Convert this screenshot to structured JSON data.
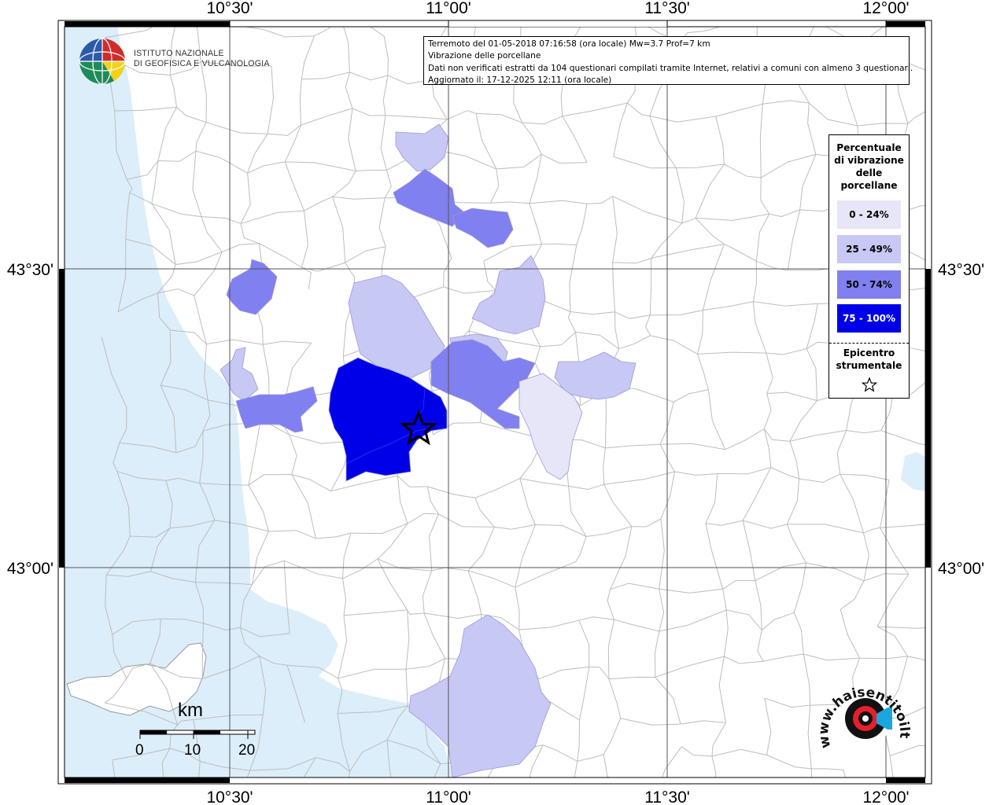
{
  "map": {
    "lon_ticks": [
      "10°30'",
      "11°00'",
      "11°30'",
      "12°00'"
    ],
    "lat_ticks": [
      "43°30'",
      "43°00'"
    ],
    "colors": {
      "sea": "#dceefa",
      "land": "#ffffff",
      "borders": "#bdbdbd",
      "grid": "#555555",
      "class_0_24": "#e6e6f8",
      "class_25_49": "#c8c8f5",
      "class_50_74": "#8080f0",
      "class_75_100": "#0000e8"
    }
  },
  "info": {
    "line1": "Terremoto del 01-05-2018 07:16:58 (ora locale) Mw=3.7 Prof=7 km",
    "line2": "Vibrazione delle porcellane",
    "line3": "Dati non verificati estratti da 104 questionari compilati tramite Internet, relativi a comuni con almeno 3 questionari.",
    "line4": "Aggiornato il: 17-12-2025 12:11 (ora locale)"
  },
  "legend": {
    "title_lines": [
      "Percentuale",
      "di vibrazione",
      "delle",
      "porcellane"
    ],
    "classes": [
      {
        "label": "0 - 24%",
        "color": "#e6e6f8",
        "text_color": "#000000"
      },
      {
        "label": "25 - 49%",
        "color": "#c8c8f5",
        "text_color": "#000000"
      },
      {
        "label": "50 - 74%",
        "color": "#8080f0",
        "text_color": "#000000"
      },
      {
        "label": "75 - 100%",
        "color": "#0000e8",
        "text_color": "#ffffff"
      }
    ],
    "epicenter_lines": [
      "Epicentro",
      "strumentale"
    ],
    "epicenter_icon": "star-icon"
  },
  "logos": {
    "ingv_line1": "ISTITUTO NAZIONALE",
    "ingv_line2": "DI GEOFISICA E VULCANOLOGIA",
    "hst_text": "www.haisentitoilterremoto.it"
  },
  "scale": {
    "unit": "km",
    "labels": [
      "0",
      "10",
      "20"
    ]
  }
}
